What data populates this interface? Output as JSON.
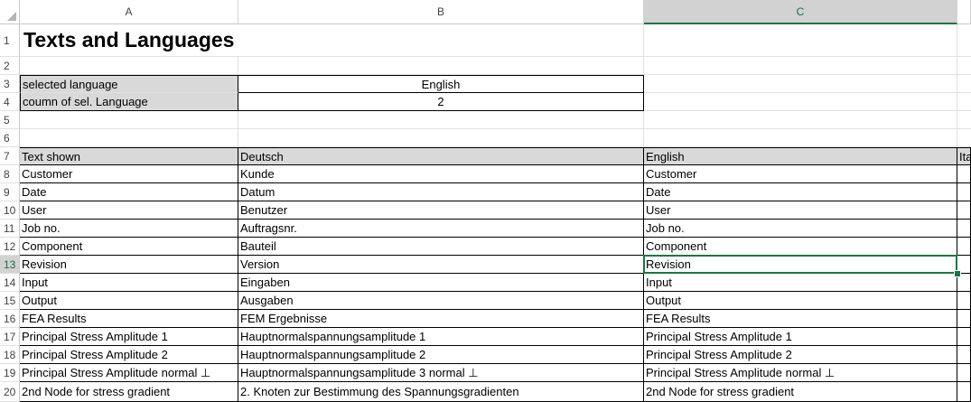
{
  "columns": [
    "A",
    "B",
    "C"
  ],
  "selected_cell": "C13",
  "title": "Texts and Languages",
  "params": {
    "selected_language_label": "selected language",
    "selected_language_value": "English",
    "column_label": "coumn of sel. Language",
    "column_value": "2"
  },
  "row_numbers": [
    "1",
    "2",
    "3",
    "4",
    "5",
    "6",
    "7",
    "8",
    "9",
    "10",
    "11",
    "12",
    "13",
    "14",
    "15",
    "16",
    "17",
    "18",
    "19",
    "20"
  ],
  "table": {
    "headers": [
      "Text shown",
      "Deutsch",
      "English",
      "Ita"
    ],
    "rows": [
      [
        "Customer",
        "Kunde",
        "Customer"
      ],
      [
        "Date",
        "Datum",
        "Date"
      ],
      [
        "User",
        "Benutzer",
        "User"
      ],
      [
        "Job no.",
        "Auftragsnr.",
        "Job no."
      ],
      [
        "Component",
        "Bauteil",
        "Component"
      ],
      [
        "Revision",
        "Version",
        "Revision"
      ],
      [
        "Input",
        "Eingaben",
        "Input"
      ],
      [
        "Output",
        "Ausgaben",
        "Output"
      ],
      [
        "FEA Results",
        "FEM Ergebnisse",
        "FEA Results"
      ],
      [
        "Principal Stress Amplitude 1",
        "Hauptnormalspannungsamplitude 1",
        "Principal Stress Amplitude 1"
      ],
      [
        "Principal Stress Amplitude 2",
        "Hauptnormalspannungsamplitude 2",
        "Principal Stress Amplitude 2"
      ],
      [
        "Principal Stress Amplitude normal ⊥",
        "Hauptnormalspannungsamplitude 3 normal ⊥",
        "Principal Stress Amplitude normal ⊥"
      ],
      [
        "2nd Node for stress gradient",
        "2. Knoten zur Bestimmung des Spannungsgradienten",
        "2nd Node for stress gradient"
      ]
    ]
  },
  "colors": {
    "accent": "#217346",
    "header_fill": "#d9d9d9"
  }
}
